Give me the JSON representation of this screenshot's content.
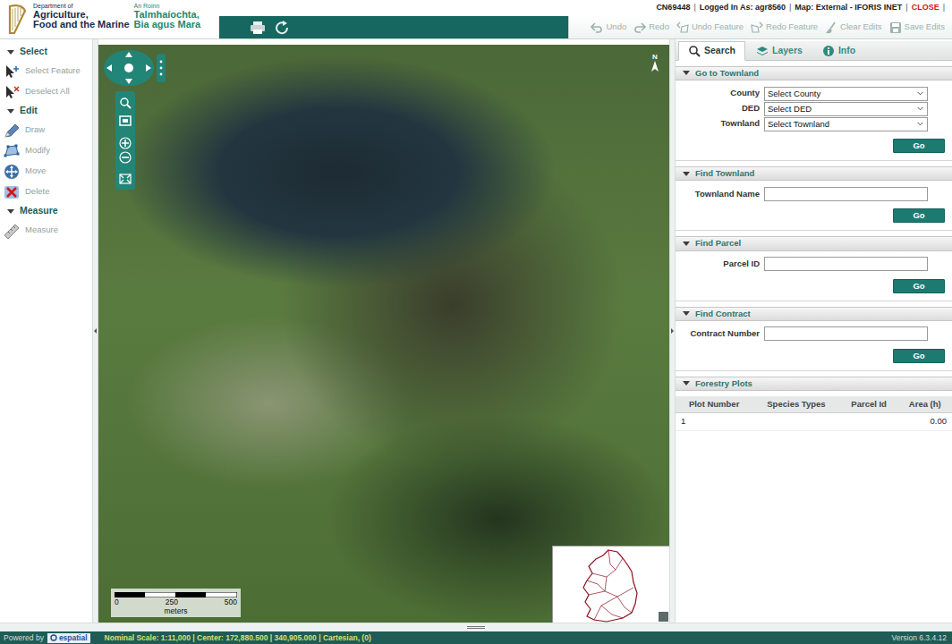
{
  "header": {
    "logo_en": [
      "Department of",
      "Agriculture,",
      "Food and the Marine"
    ],
    "logo_ga": [
      "An Roinn",
      "Talmhaíochta,",
      "Bia agus Mara"
    ],
    "user_bar": {
      "separator": "|",
      "items": [
        {
          "label": "CN69448",
          "kind": "info"
        },
        {
          "label": "Logged In As: agr8560",
          "kind": "info"
        },
        {
          "label": "Map: External - IFORIS INET",
          "kind": "info"
        },
        {
          "label": "CLOSE",
          "kind": "link"
        }
      ]
    },
    "toolbar": [
      {
        "label": "Undo",
        "disabled": true
      },
      {
        "label": "Redo",
        "disabled": true
      },
      {
        "label": "Undo Feature",
        "disabled": true
      },
      {
        "label": "Redo Feature",
        "disabled": true
      },
      {
        "label": "Clear Edits",
        "disabled": true
      },
      {
        "label": "Save Edits",
        "disabled": true
      }
    ]
  },
  "left_panel": [
    {
      "title": "Select",
      "expanded": true,
      "items": [
        {
          "label": "Select Feature",
          "disabled": true
        },
        {
          "label": "Deselect All",
          "disabled": true
        }
      ]
    },
    {
      "title": "Edit",
      "expanded": true,
      "items": [
        {
          "label": "Draw",
          "disabled": true
        },
        {
          "label": "Modify",
          "disabled": true
        },
        {
          "label": "Move",
          "disabled": true
        },
        {
          "label": "Delete",
          "disabled": true
        }
      ]
    },
    {
      "title": "Measure",
      "expanded": true,
      "items": [
        {
          "label": "Measure",
          "disabled": true
        }
      ]
    }
  ],
  "map": {
    "north": "N",
    "scale_bar": {
      "ticks": [
        "0",
        "250",
        "500"
      ],
      "unit": "meters"
    }
  },
  "right_panel": {
    "tabs": [
      {
        "label": "Search",
        "selected": true
      },
      {
        "label": "Layers",
        "selected": false
      },
      {
        "label": "Info",
        "selected": false
      }
    ],
    "sections": [
      {
        "title": "Go to Townland",
        "expanded": true,
        "fields": [
          {
            "label": "County",
            "kind": "select",
            "value": "Select County"
          },
          {
            "label": "DED",
            "kind": "select",
            "value": "Select DED"
          },
          {
            "label": "Townland",
            "kind": "select",
            "value": "Select Townland"
          }
        ],
        "button": "Go"
      },
      {
        "title": "Find Townland",
        "expanded": true,
        "fields": [
          {
            "label": "Townland Name",
            "kind": "input",
            "value": ""
          }
        ],
        "button": "Go"
      },
      {
        "title": "Find Parcel",
        "expanded": true,
        "fields": [
          {
            "label": "Parcel ID",
            "kind": "input",
            "value": ""
          }
        ],
        "button": "Go"
      },
      {
        "title": "Find Contract",
        "expanded": true,
        "fields": [
          {
            "label": "Contract Number",
            "kind": "input",
            "value": ""
          }
        ],
        "button": "Go"
      }
    ],
    "plots": {
      "title": "Forestry Plots",
      "expanded": true,
      "columns": [
        "Plot Number",
        "Species Types",
        "Parcel Id",
        "Area (h)"
      ],
      "rows": [
        [
          "1",
          "",
          "",
          "0.00"
        ]
      ]
    }
  },
  "footer": {
    "powered_by": "Powered by",
    "brand": "espatial",
    "status": "Nominal Scale: 1:11,000 | Center: 172,880.500 | 340,905.000 | Cartesian, (0)",
    "version": "Version 6.3.4.12"
  }
}
